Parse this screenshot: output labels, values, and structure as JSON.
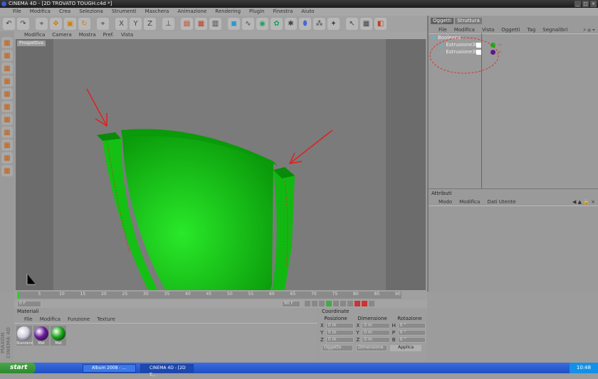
{
  "window": {
    "title": "CINEMA 4D - [2D TROVATO TOUGH.c4d *]",
    "controls": [
      "_",
      "□",
      "×"
    ]
  },
  "menu": [
    "File",
    "Modifica",
    "Crea",
    "Seleziona",
    "Strumenti",
    "Maschera",
    "Animazione",
    "Rendering",
    "Plugin",
    "Finestra",
    "Aiuto"
  ],
  "toolbar_icons": [
    "undo-icon",
    "redo-icon",
    "live-select-icon",
    "move-icon",
    "scale-icon",
    "rotate-icon",
    "last-tool-icon",
    "x-axis-icon",
    "y-axis-icon",
    "z-axis-icon",
    "coord-system-icon",
    "render-view-icon",
    "render-picture-icon",
    "render-settings-icon",
    "cube-icon",
    "spline-icon",
    "nurbs-icon",
    "array-icon",
    "deformer-icon",
    "scene-icon",
    "camera-icon",
    "light-icon",
    "cursor-icon",
    "layout-icon",
    "plugin-icon"
  ],
  "viewport": {
    "menu": [
      "Modifica",
      "Camera",
      "Mostra",
      "Pref.",
      "Vista"
    ],
    "label": "Prospettiva"
  },
  "object_manager": {
    "tabs": [
      "Oggetti",
      "Struttura"
    ],
    "menu": [
      "File",
      "Modifica",
      "Vista",
      "Oggetti",
      "Tag",
      "Segnalibri"
    ],
    "objects": [
      {
        "name": "Booleana",
        "level": 0
      },
      {
        "name": "Estrusione3D",
        "level": 1,
        "material_color": "#18b018"
      },
      {
        "name": "Estrusione3D",
        "level": 1,
        "material_color": "#5a1a8a"
      }
    ]
  },
  "attributes": {
    "title": "Attributi",
    "menu": [
      "Modo",
      "Modifica",
      "Dati Utente"
    ]
  },
  "timeline": {
    "ticks": [
      "0",
      "5",
      "10",
      "15",
      "20",
      "25",
      "30",
      "35",
      "40",
      "45",
      "50",
      "55",
      "60",
      "65",
      "70",
      "75",
      "80",
      "85",
      "90"
    ],
    "current": "0 F",
    "end": "90 F"
  },
  "materials": {
    "title": "Materiali",
    "menu": [
      "File",
      "Modifica",
      "Funzione",
      "Texture"
    ],
    "items": [
      {
        "name": "Standard",
        "color": "#d0d0e0"
      },
      {
        "name": "Mat",
        "color": "#6a1a9a"
      },
      {
        "name": "Mat",
        "color": "#18a818"
      }
    ]
  },
  "coordinates": {
    "title": "Coordinate",
    "headers": [
      "Posizione",
      "Dimensione",
      "Rotazione"
    ],
    "rows": [
      {
        "axis": "X",
        "pos": "0 m",
        "size": "0 m",
        "rlabel": "H",
        "rot": "0 °"
      },
      {
        "axis": "Y",
        "pos": "0 m",
        "size": "0 m",
        "rlabel": "P",
        "rot": "0 °"
      },
      {
        "axis": "Z",
        "pos": "0 m",
        "size": "0 m",
        "rlabel": "B",
        "rot": "0 °"
      }
    ],
    "mode": "Oggetto",
    "size_mode": "Dimensione",
    "apply": "Applica"
  },
  "brand": "MAXON CINEMA 4D",
  "taskbar": {
    "start": "start",
    "tasks": [
      "Album 2008 - ...",
      "CINEMA 4D - [2D T..."
    ],
    "clock": "10:48"
  },
  "colors": {
    "object_green": "#12c212",
    "annotation_red": "#e02020"
  }
}
